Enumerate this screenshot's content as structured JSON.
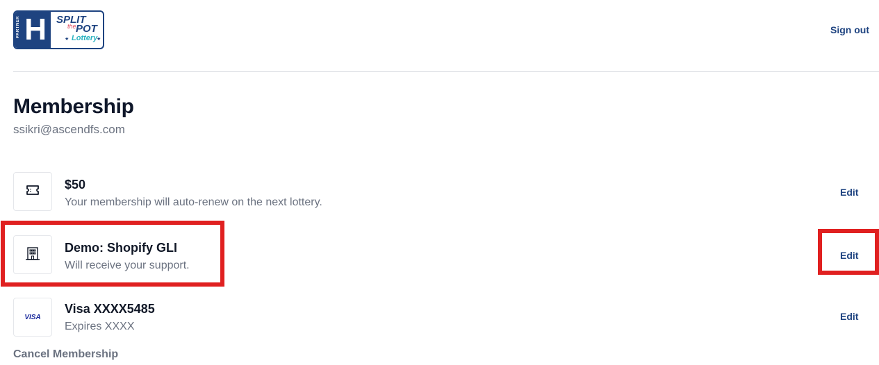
{
  "header": {
    "logo": {
      "partner_text": "PARTNER",
      "h_letter": "H",
      "split_text": "SPLIT",
      "the_text": "the",
      "pot_text": "POT",
      "lottery_text": "Lottery"
    },
    "sign_out_label": "Sign out"
  },
  "main": {
    "title": "Membership",
    "email": "ssikri@ascendfs.com",
    "rows": [
      {
        "icon": "ticket-icon",
        "title": "$50",
        "subtitle": "Your membership will auto-renew on the next lottery.",
        "edit_label": "Edit"
      },
      {
        "icon": "building-icon",
        "title": "Demo: Shopify GLI",
        "subtitle": "Will receive your support.",
        "edit_label": "Edit"
      },
      {
        "icon": "visa-card-icon",
        "icon_text": "VISA",
        "title": "Visa XXXX5485",
        "subtitle": "Expires XXXX",
        "edit_label": "Edit"
      }
    ],
    "cancel_label": "Cancel Membership"
  },
  "colors": {
    "brand": "#1e4380",
    "highlight": "#e02020",
    "muted_text": "#6b7280"
  }
}
